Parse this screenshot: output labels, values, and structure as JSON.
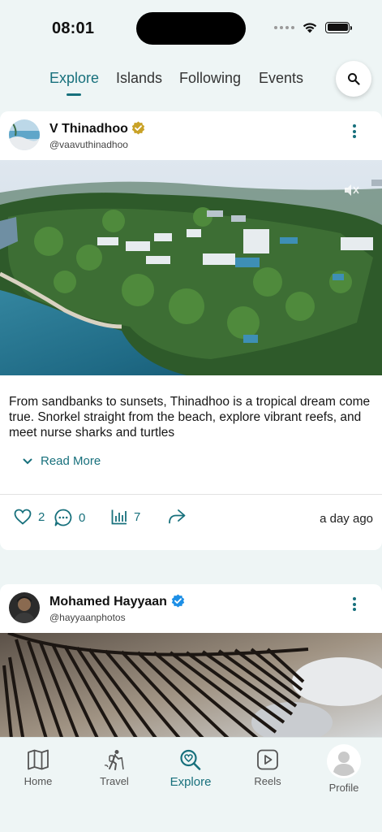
{
  "status_bar": {
    "time": "08:01"
  },
  "top_tabs": [
    {
      "label": "Explore",
      "active": true
    },
    {
      "label": "Islands",
      "active": false
    },
    {
      "label": "Following",
      "active": false
    },
    {
      "label": "Events",
      "active": false
    }
  ],
  "icons": {
    "search": "search-icon",
    "verified": "verified-badge-icon",
    "more": "more-vertical-icon",
    "like": "heart-icon",
    "comment": "comment-icon",
    "views": "bar-chart-icon",
    "share": "share-arrow-icon",
    "read_more": "chevron-down-icon",
    "mute": "mute-icon"
  },
  "colors": {
    "accent": "#17707c",
    "verified_gold": "#c9a227",
    "verified_blue": "#1d8fe6",
    "background": "#eef5f5"
  },
  "posts": [
    {
      "author": "V Thinadhoo",
      "handle": "@vaavuthinadhoo",
      "verified_color": "#c9a227",
      "text": "From sandbanks to sunsets, Thinadhoo is a tropical dream come true. Snorkel straight from the beach, explore vibrant reefs, and meet nurse sharks and turtles",
      "read_more": "Read More",
      "likes": "2",
      "comments": "0",
      "views": "7",
      "time_ago": "a day ago"
    },
    {
      "author": "Mohamed Hayyaan",
      "handle": "@hayyaanphotos",
      "verified_color": "#1d8fe6"
    }
  ],
  "bottom_nav": [
    {
      "label": "Home",
      "icon": "map-icon",
      "active": false
    },
    {
      "label": "Travel",
      "icon": "hiker-icon",
      "active": false
    },
    {
      "label": "Explore",
      "icon": "search-heart-icon",
      "active": true
    },
    {
      "label": "Reels",
      "icon": "play-icon",
      "active": false
    },
    {
      "label": "Profile",
      "icon": "avatar-placeholder-icon",
      "active": false
    }
  ]
}
